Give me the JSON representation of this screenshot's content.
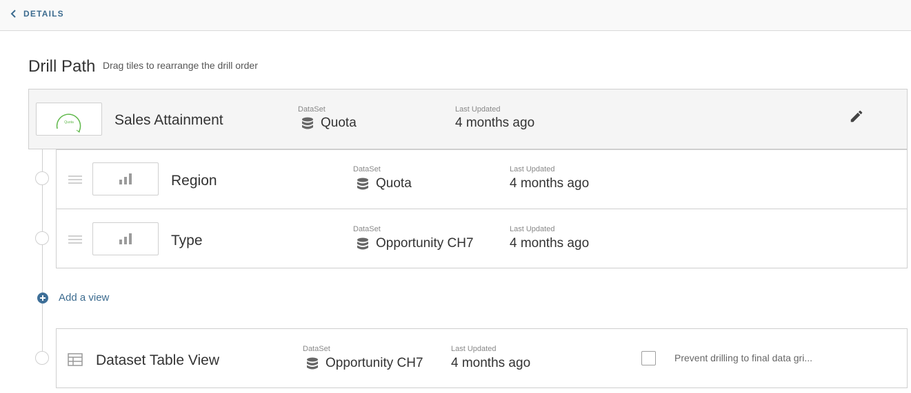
{
  "header": {
    "back_label": "DETAILS"
  },
  "page": {
    "title": "Drill Path",
    "subtitle": "Drag tiles to rearrange the drill order"
  },
  "root_card": {
    "name": "Sales Attainment",
    "dataset_label": "DataSet",
    "dataset_value": "Quota",
    "updated_label": "Last Updated",
    "updated_value": "4 months ago",
    "thumb_text": "Quota"
  },
  "views": [
    {
      "name": "Region",
      "dataset_label": "DataSet",
      "dataset_value": "Quota",
      "updated_label": "Last Updated",
      "updated_value": "4 months ago"
    },
    {
      "name": "Type",
      "dataset_label": "DataSet",
      "dataset_value": "Opportunity CH7",
      "updated_label": "Last Updated",
      "updated_value": "4 months ago"
    }
  ],
  "add_view_label": "Add a view",
  "table_view": {
    "name": "Dataset Table View",
    "dataset_label": "DataSet",
    "dataset_value": "Opportunity CH7",
    "updated_label": "Last Updated",
    "updated_value": "4 months ago",
    "prevent_label": "Prevent drilling to final data gri...",
    "prevent_checked": false
  },
  "colors": {
    "accent": "#3e6f98",
    "link": "#3c6b8f",
    "gauge": "#5fb84a",
    "border": "#cfcfcf"
  },
  "icons": [
    "chevron-left-icon",
    "pencil-icon",
    "database-icon",
    "bar-chart-icon",
    "drag-handle-icon",
    "plus-circle-icon",
    "table-icon",
    "gauge-icon"
  ]
}
